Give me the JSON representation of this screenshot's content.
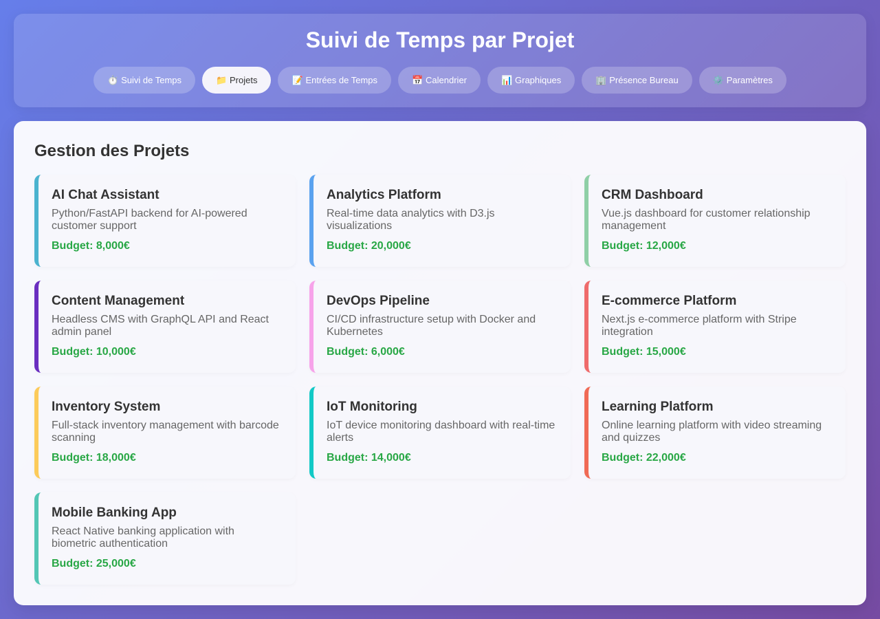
{
  "header": {
    "title": "Suivi de Temps par Projet",
    "tabs": [
      {
        "icon": "stopwatch-icon",
        "glyph": "⏱️",
        "label": "Suivi de Temps",
        "active": false
      },
      {
        "icon": "folder-icon",
        "glyph": "📁",
        "label": "Projets",
        "active": true
      },
      {
        "icon": "memo-icon",
        "glyph": "📝",
        "label": "Entrées de Temps",
        "active": false
      },
      {
        "icon": "calendar-icon",
        "glyph": "📅",
        "label": "Calendrier",
        "active": false
      },
      {
        "icon": "bar-chart-icon",
        "glyph": "📊",
        "label": "Graphiques",
        "active": false
      },
      {
        "icon": "office-building-icon",
        "glyph": "🏢",
        "label": "Présence Bureau",
        "active": false
      },
      {
        "icon": "gear-icon",
        "glyph": "⚙️",
        "label": "Paramètres",
        "active": false
      }
    ]
  },
  "main": {
    "section_title": "Gestion des Projets",
    "projects": [
      {
        "name": "AI Chat Assistant",
        "description": "Python/FastAPI backend for AI-powered customer support",
        "budget": "Budget: 8,000€",
        "color": "#4bb3cf"
      },
      {
        "name": "Analytics Platform",
        "description": "Real-time data analytics with D3.js visualizations",
        "budget": "Budget: 20,000€",
        "color": "#5aa2ef"
      },
      {
        "name": "CRM Dashboard",
        "description": "Vue.js dashboard for customer relationship management",
        "budget": "Budget: 12,000€",
        "color": "#8fcfa6"
      },
      {
        "name": "Content Management",
        "description": "Headless CMS with GraphQL API and React admin panel",
        "budget": "Budget: 10,000€",
        "color": "#6a2ec0"
      },
      {
        "name": "DevOps Pipeline",
        "description": "CI/CD infrastructure setup with Docker and Kubernetes",
        "budget": "Budget: 6,000€",
        "color": "#f7a3ea"
      },
      {
        "name": "E-commerce Platform",
        "description": "Next.js e-commerce platform with Stripe integration",
        "budget": "Budget: 15,000€",
        "color": "#ef6b6b"
      },
      {
        "name": "Inventory System",
        "description": "Full-stack inventory management with barcode scanning",
        "budget": "Budget: 18,000€",
        "color": "#fccb5a"
      },
      {
        "name": "IoT Monitoring",
        "description": "IoT device monitoring dashboard with real-time alerts",
        "budget": "Budget: 14,000€",
        "color": "#12c9c6"
      },
      {
        "name": "Learning Platform",
        "description": "Online learning platform with video streaming and quizzes",
        "budget": "Budget: 22,000€",
        "color": "#f06a55"
      },
      {
        "name": "Mobile Banking App",
        "description": "React Native banking application with biometric authentication",
        "budget": "Budget: 25,000€",
        "color": "#53c6b5"
      }
    ]
  }
}
